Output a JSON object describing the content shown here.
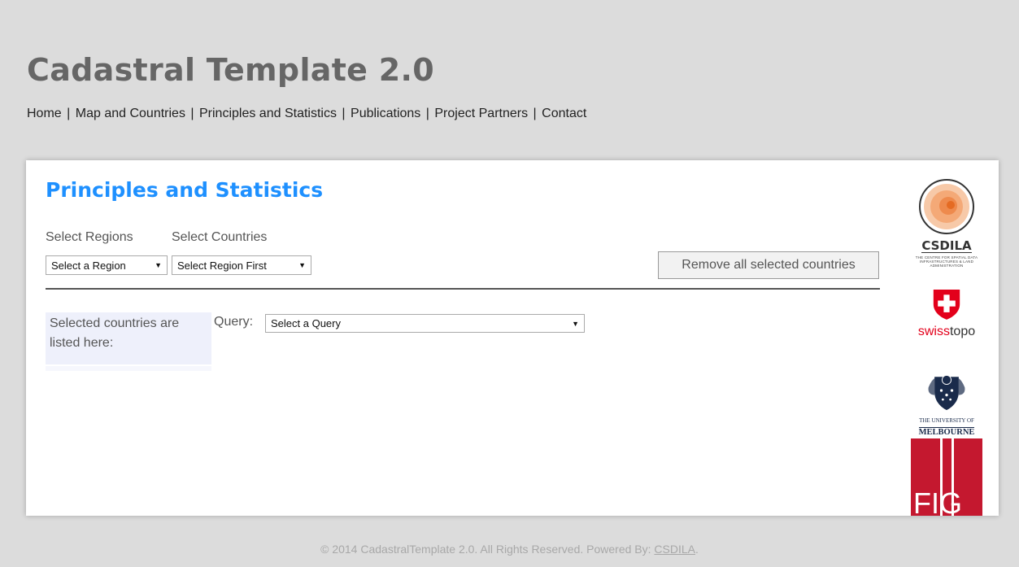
{
  "site": {
    "title": "Cadastral Template 2.0"
  },
  "nav": [
    {
      "label": "Home"
    },
    {
      "label": "Map and Countries"
    },
    {
      "label": "Principles and Statistics"
    },
    {
      "label": "Publications"
    },
    {
      "label": "Project Partners"
    },
    {
      "label": "Contact"
    }
  ],
  "nav_separator": "|",
  "page": {
    "title": "Principles and Statistics",
    "select_regions_label": "Select Regions",
    "select_countries_label": "Select Countries",
    "region_select_value": "Select a Region",
    "country_select_value": "Select Region First",
    "remove_button": "Remove all selected countries",
    "selected_countries_text": "Selected countries are listed here:",
    "query_label": "Query:",
    "query_select_value": "Select a Query"
  },
  "logos": {
    "csdila": {
      "name": "CSDILA",
      "subtitle": "THE CENTRE FOR SPATIAL DATA INFRASTRUCTURES & LAND ADMINISTRATION"
    },
    "swisstopo": {
      "part1": "swiss",
      "part2": "topo"
    },
    "melbourne": {
      "line1": "THE UNIVERSITY OF",
      "line2": "MELBOURNE"
    },
    "fig": {
      "text": "FIG"
    }
  },
  "footer": {
    "text": "© 2014 CadastralTemplate 2.0. All Rights Reserved. Powered By:",
    "link": "CSDILA",
    "end": "."
  },
  "colors": {
    "accent": "#1e90ff",
    "fig_red": "#c4182f",
    "swiss_red": "#e3001b"
  }
}
